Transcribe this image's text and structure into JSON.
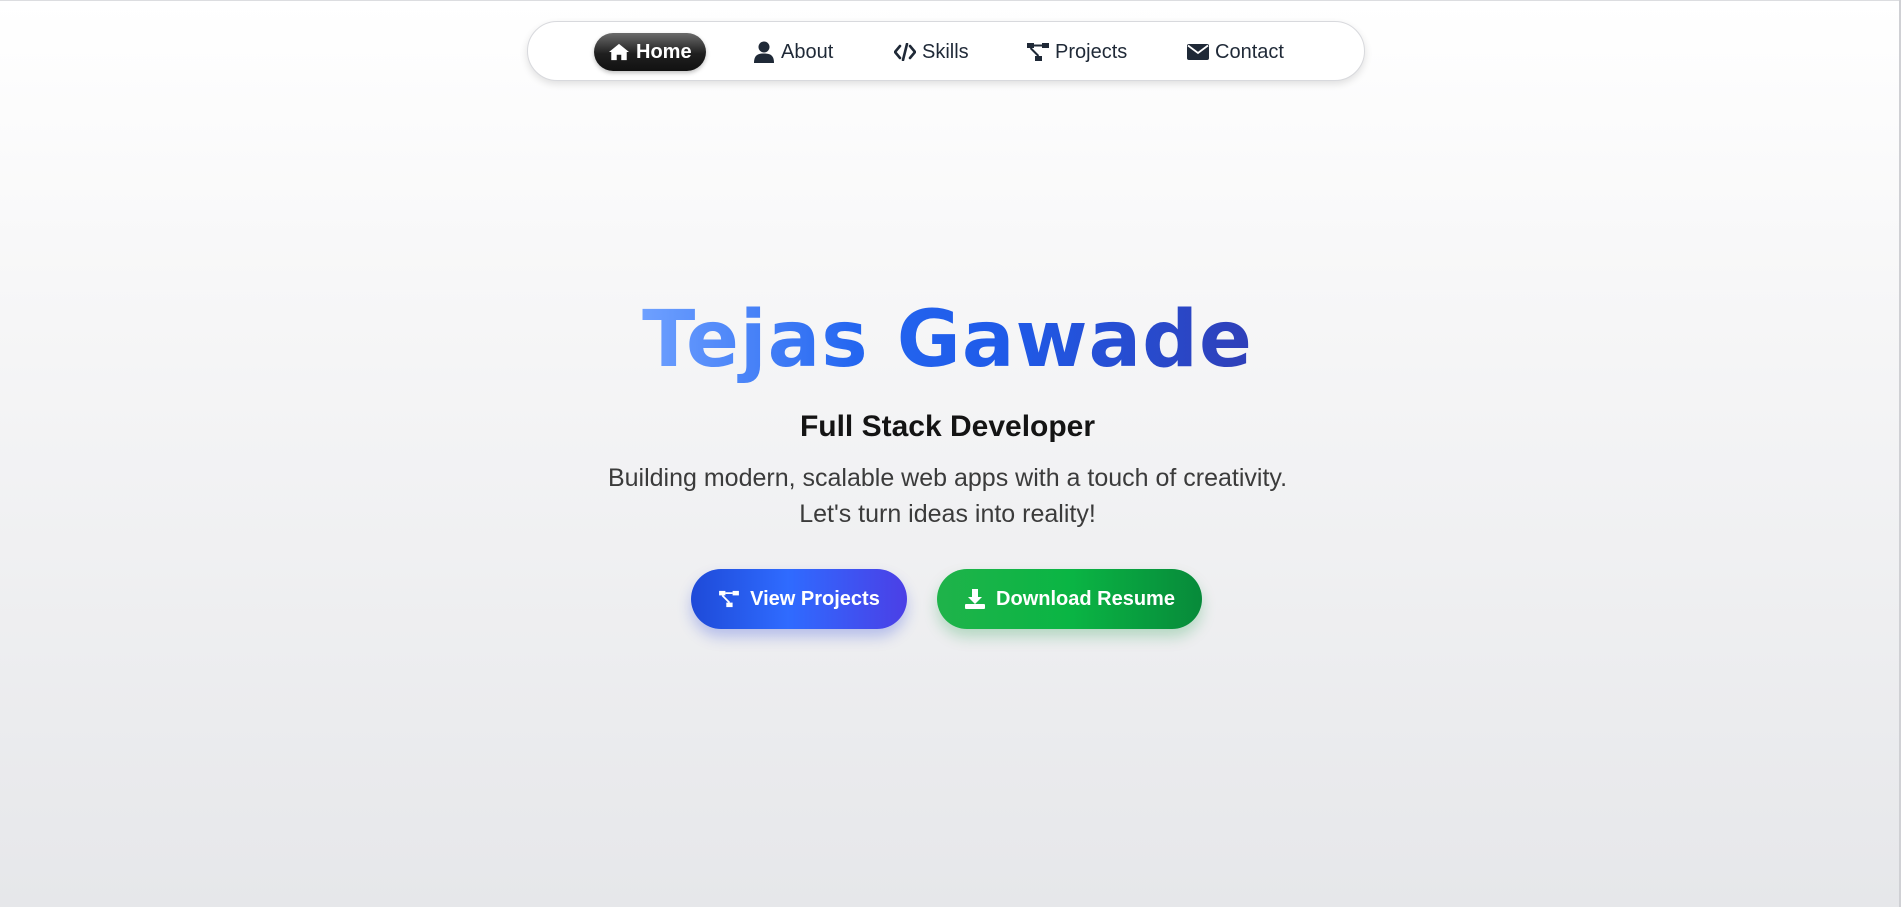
{
  "nav": {
    "items": [
      {
        "label": "Home",
        "icon": "home-icon",
        "active": true
      },
      {
        "label": "About",
        "icon": "user-icon",
        "active": false
      },
      {
        "label": "Skills",
        "icon": "code-icon",
        "active": false
      },
      {
        "label": "Projects",
        "icon": "project-diagram-icon",
        "active": false
      },
      {
        "label": "Contact",
        "icon": "envelope-icon",
        "active": false
      }
    ]
  },
  "hero": {
    "name": "Tejas Gawade",
    "role": "Full Stack Developer",
    "description_line1": "Building modern, scalable web apps with a touch of creativity.",
    "description_line2": "Let's turn ideas into reality!",
    "buttons": {
      "projects_label": "View Projects",
      "resume_label": "Download Resume"
    }
  },
  "colors": {
    "title_gradient_start": "#6ea0ff",
    "title_gradient_end": "#2f3fb8",
    "primary_blue": "#2f6bff",
    "success_green": "#0ab544",
    "nav_active": "#1f1f1f"
  }
}
